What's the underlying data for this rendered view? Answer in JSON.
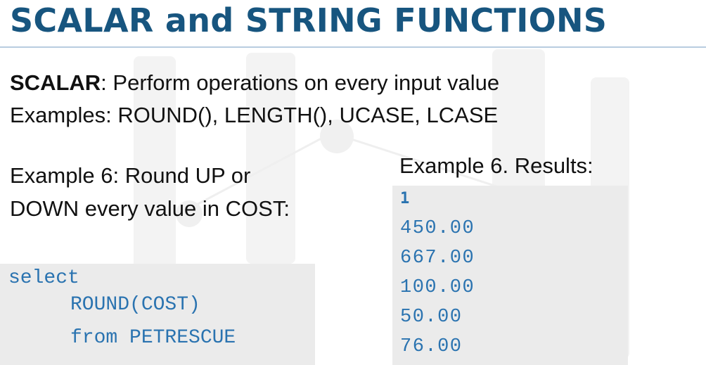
{
  "slide": {
    "title": "SCALAR and STRING FUNCTIONS",
    "scalar_label": "SCALAR",
    "scalar_desc": ": Perform operations on every input value",
    "examples_line": "Examples: ROUND(), LENGTH(), UCASE, LCASE",
    "example6_line1": "Example 6: Round UP or",
    "example6_line2": "DOWN every value in COST:"
  },
  "query": {
    "line1": "select",
    "line2": "ROUND(COST)",
    "line3": "from PETRESCUE"
  },
  "results": {
    "title": "Example 6. Results:",
    "column_header": "1",
    "rows": [
      "450.00",
      "667.00",
      "100.00",
      "50.00",
      "76.00"
    ]
  },
  "colors": {
    "title": "#17557f",
    "code": "#2a73b0",
    "code_background": "#ebebeb"
  }
}
